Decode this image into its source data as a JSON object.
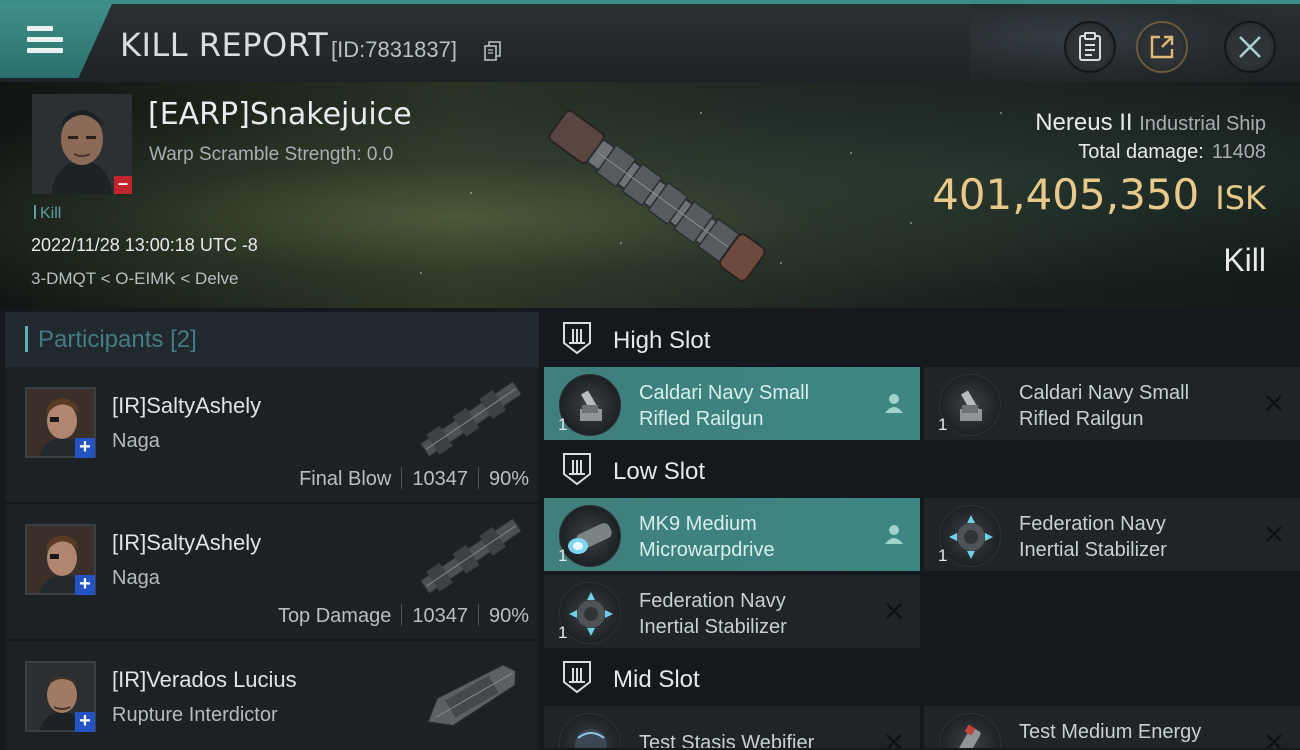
{
  "header": {
    "title": "KILL REPORT",
    "id_text": "[ID:7831837]"
  },
  "victim": {
    "name": "[EARP]Snakejuice",
    "warp_scramble": "Warp Scramble Strength: 0.0",
    "kill_tag": "Kill",
    "date": "2022/11/28 13:00:18 UTC -8",
    "location": "3-DMQT < O-EIMK < Delve",
    "ship": "Nereus II",
    "ship_class": "Industrial Ship",
    "total_damage_label": "Total damage:",
    "total_damage": "11408",
    "isk_value": "401,405,350",
    "isk_unit": "ISK",
    "result": "Kill"
  },
  "participants": {
    "label": "Participants",
    "count": "[2]",
    "rows": [
      {
        "name": "[IR]SaltyAshely",
        "ship": "Naga",
        "role": "Final Blow",
        "damage": "10347",
        "percent": "90%"
      },
      {
        "name": "[IR]SaltyAshely",
        "ship": "Naga",
        "role": "Top Damage",
        "damage": "10347",
        "percent": "90%"
      },
      {
        "name": "[IR]Verados Lucius",
        "ship": "Rupture Interdictor"
      }
    ]
  },
  "fittings": {
    "high": {
      "title": "High Slot",
      "modules": [
        {
          "name_line1": "Caldari Navy Small",
          "name_line2": "Rifled Railgun",
          "qty": "1",
          "status": "dropped"
        },
        {
          "name_line1": "Caldari Navy Small",
          "name_line2": "Rifled Railgun",
          "qty": "1",
          "status": "destroyed"
        }
      ]
    },
    "low": {
      "title": "Low Slot",
      "modules": [
        {
          "name_line1": "MK9 Medium",
          "name_line2": "Microwarpdrive",
          "qty": "1",
          "status": "dropped"
        },
        {
          "name_line1": "Federation Navy",
          "name_line2": "Inertial Stabilizer",
          "qty": "1",
          "status": "destroyed"
        },
        {
          "name_line1": "Federation Navy",
          "name_line2": "Inertial Stabilizer",
          "qty": "1",
          "status": "destroyed"
        }
      ]
    },
    "mid": {
      "title": "Mid Slot",
      "modules": [
        {
          "name_line1": "Test Stasis Webifier",
          "status": "destroyed"
        },
        {
          "name_line1": "Test Medium Energy",
          "status": "destroyed"
        }
      ]
    }
  },
  "colors": {
    "accent": "#3f8f8a",
    "isk": "#e8c98a",
    "dropped_row": "#3f7f7c",
    "loss_badge": "#c0262b",
    "corp_badge": "#2454c4"
  },
  "icons": {
    "menu": "hamburger-icon",
    "copy": "copy-icon",
    "report": "clipboard-icon",
    "share": "share-icon",
    "close": "close-icon",
    "dropped": "person-icon",
    "destroyed": "x-icon"
  }
}
